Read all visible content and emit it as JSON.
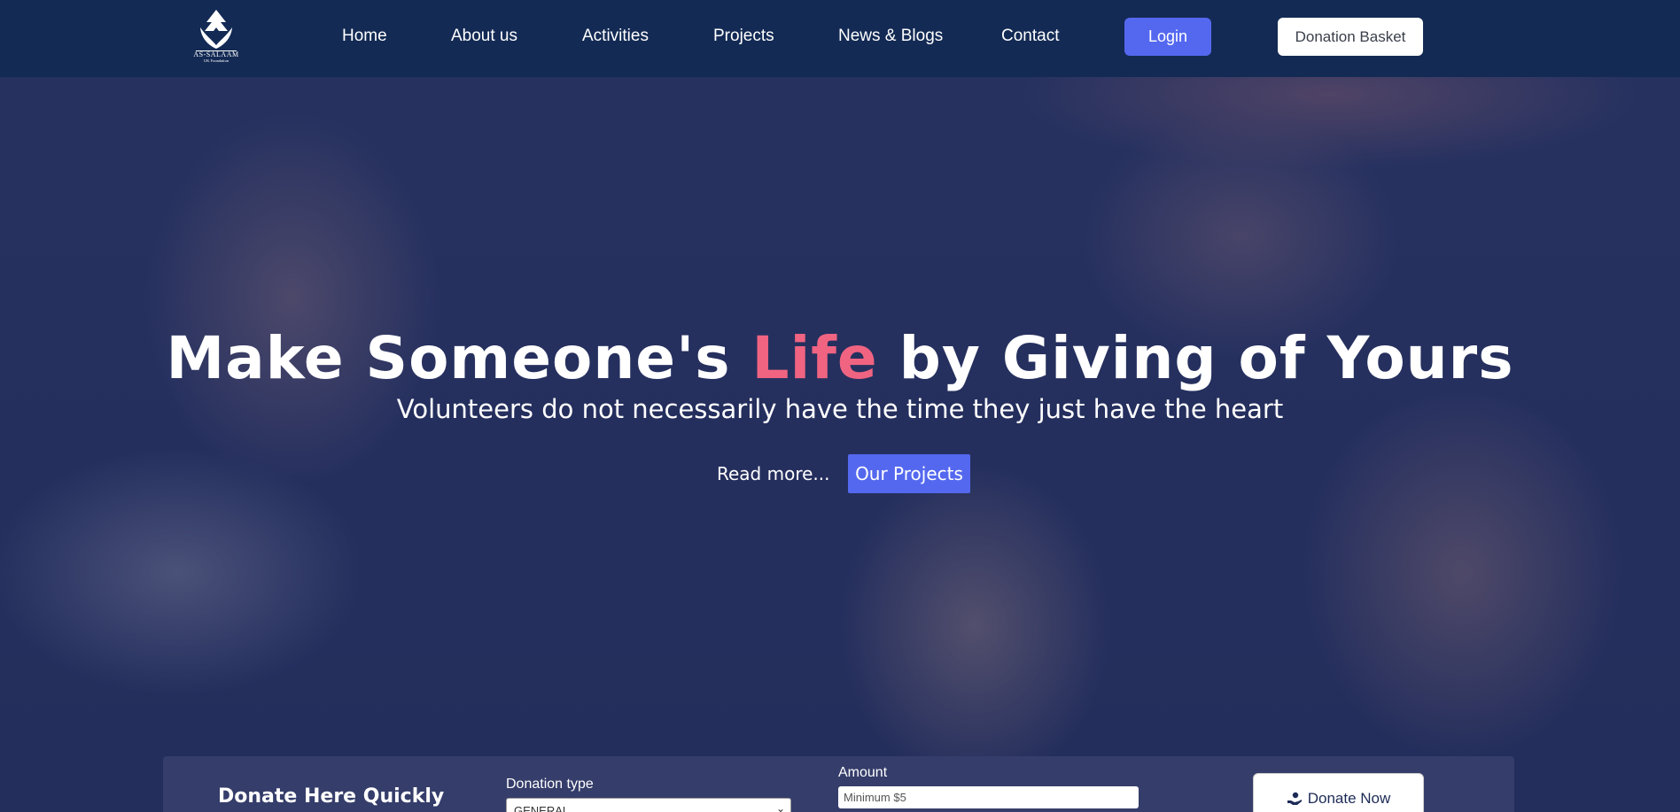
{
  "nav": {
    "logo": {
      "name": "AS-SALAAM",
      "tagline": "UK Foundation"
    },
    "links": [
      "Home",
      "About us",
      "Activities",
      "Projects",
      "News & Blogs",
      "Contact"
    ],
    "login_label": "Login",
    "basket_label": "Donation Basket"
  },
  "hero": {
    "title_before": "Make Someone's ",
    "title_accent": "Life",
    "title_after": " by Giving of Yours",
    "subtitle": "Volunteers do not necessarily have the time they just have the heart",
    "read_more": "Read more...",
    "projects_button": "Our Projects"
  },
  "donate": {
    "title": "Donate Here Quickly",
    "type_label": "Donation type",
    "type_selected": "GENERAL",
    "amount_label": "Amount",
    "amount_placeholder": "Minimum $5",
    "donate_button": "Donate Now"
  },
  "colors": {
    "nav_bg": "#132a54",
    "accent_blue": "#5468ef",
    "accent_pink": "#f06482",
    "donate_bar_bg": "#353d6a"
  },
  "icons": [
    "hand-donate-icon",
    "chevron-down-icon"
  ]
}
